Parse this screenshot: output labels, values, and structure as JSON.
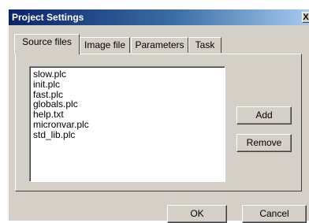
{
  "window": {
    "title": "Project Settings",
    "close_label": "X"
  },
  "tabs": [
    {
      "label": "Source files",
      "active": true
    },
    {
      "label": "Image file",
      "active": false
    },
    {
      "label": "Parameters",
      "active": false
    },
    {
      "label": "Task",
      "active": false
    }
  ],
  "source_files": {
    "items": [
      "slow.plc",
      "init.plc",
      "fast.plc",
      "globals.plc",
      "help.txt",
      "micronvar.plc",
      "std_lib.plc"
    ]
  },
  "buttons": {
    "add": "Add",
    "remove": "Remove",
    "ok": "OK",
    "cancel": "Cancel"
  }
}
